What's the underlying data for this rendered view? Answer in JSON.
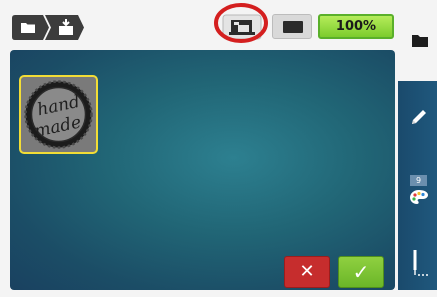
{
  "topbar": {
    "breadcrumb_icons": [
      "folder-icon",
      "import-icon"
    ],
    "machine_icon": "embroidery-machine-icon",
    "hoop_icon": "hoop-icon",
    "zoom_label": "100%"
  },
  "workspace": {
    "motif": {
      "icon": "hand-made-stamp",
      "line1": "hand",
      "line2": "made"
    },
    "cancel_label": "✕",
    "confirm_label": "✓"
  },
  "sidebar": {
    "top_icon": "folder-icon",
    "edit_icon": "pencil-icon",
    "color_count": "9",
    "color_icon": "color-palette-icon",
    "stitch_icon": "needle-icon"
  },
  "colors": {
    "accent_zoom": "#8ed63c",
    "highlight_ring": "#d41f1f",
    "selection_border": "#f2dd36",
    "cancel": "#c62d2d",
    "confirm": "#77c02f",
    "canvas": "#216676",
    "sidebar": "#1c4f72"
  }
}
